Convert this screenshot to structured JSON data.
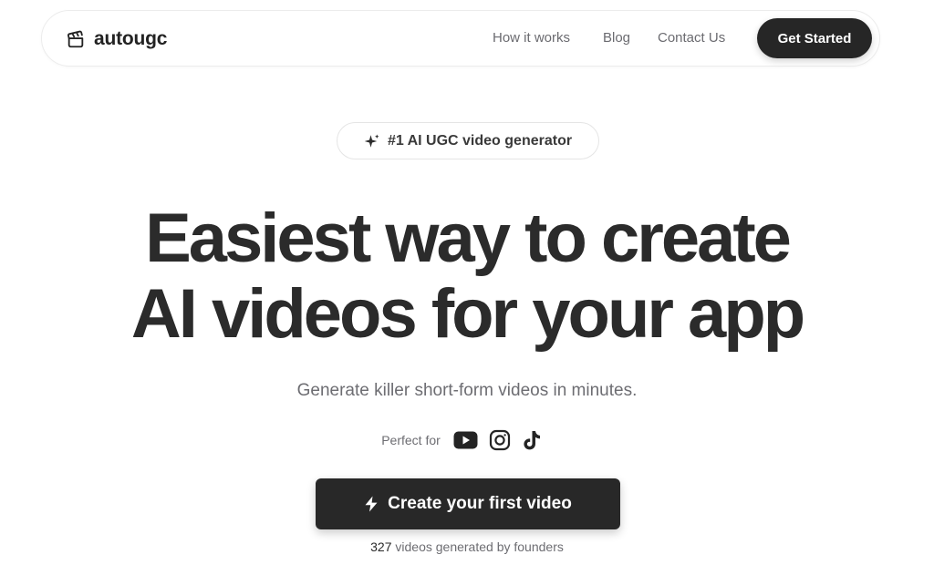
{
  "nav": {
    "brand": "autougc",
    "links": [
      "How it works",
      "Blog",
      "Contact Us"
    ],
    "cta": "Get Started"
  },
  "hero": {
    "badge": "#1 AI UGC video generator",
    "headline_line1": "Easiest way to create",
    "headline_line2": "AI videos for your app",
    "subheadline": "Generate killer short-form videos in minutes.",
    "perfect_for": "Perfect for",
    "platform_icons": [
      "youtube-icon",
      "instagram-icon",
      "tiktok-icon"
    ],
    "cta": "Create your first video",
    "stats_count": "327",
    "stats_text": " videos generated by founders"
  },
  "colors": {
    "primary_dark": "#262626",
    "text_muted": "#6d6d72",
    "border": "#e5e5e5"
  }
}
